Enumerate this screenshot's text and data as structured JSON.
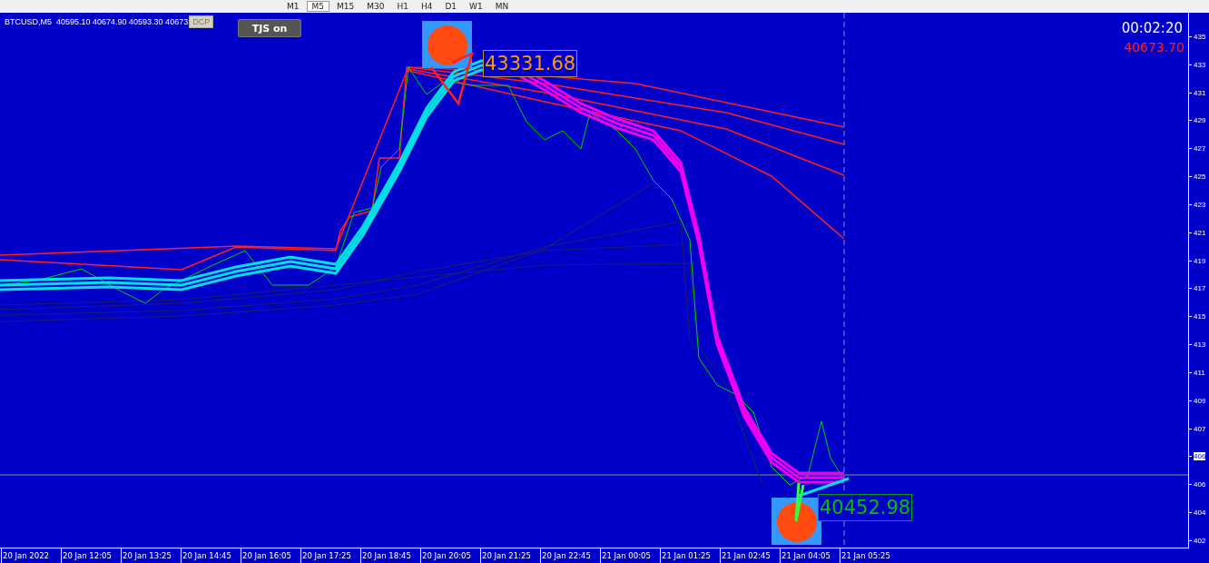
{
  "toolbar": {
    "timeframes": [
      {
        "label": "M1",
        "selected": false
      },
      {
        "label": "M5",
        "selected": true
      },
      {
        "label": "M15",
        "selected": false
      },
      {
        "label": "M30",
        "selected": false
      },
      {
        "label": "H1",
        "selected": false
      },
      {
        "label": "H4",
        "selected": false
      },
      {
        "label": "D1",
        "selected": false
      },
      {
        "label": "W1",
        "selected": false
      },
      {
        "label": "MN",
        "selected": false
      }
    ]
  },
  "chart": {
    "symbol_info": "BTCUSD,M5  40595.10 40674.90 40593.30 40673",
    "badge": "DCP",
    "toggle_button": "TJS on",
    "timer": "00:02:20",
    "bid": "40673.70",
    "high_label": "43331.68",
    "low_label": "40452.98",
    "price_axis": [
      {
        "label": "435",
        "kind": "tick"
      },
      {
        "label": "433",
        "kind": "tick"
      },
      {
        "label": "431",
        "kind": "tick"
      },
      {
        "label": "429",
        "kind": "tick"
      },
      {
        "label": "427",
        "kind": "tick"
      },
      {
        "label": "425",
        "kind": "tick"
      },
      {
        "label": "423",
        "kind": "tick"
      },
      {
        "label": "421",
        "kind": "tick"
      },
      {
        "label": "419",
        "kind": "tick"
      },
      {
        "label": "417",
        "kind": "tick"
      },
      {
        "label": "415",
        "kind": "tick"
      },
      {
        "label": "413",
        "kind": "tick"
      },
      {
        "label": "411",
        "kind": "tick"
      },
      {
        "label": "409",
        "kind": "tick"
      },
      {
        "label": "407",
        "kind": "tick"
      },
      {
        "label": "406",
        "kind": "current"
      },
      {
        "label": "406",
        "kind": "tick"
      },
      {
        "label": "404",
        "kind": "tick"
      },
      {
        "label": "402",
        "kind": "tick"
      }
    ],
    "time_axis": [
      "20 Jan 2022",
      "20 Jan 12:05",
      "20 Jan 13:25",
      "20 Jan 14:45",
      "20 Jan 16:05",
      "20 Jan 17:25",
      "20 Jan 18:45",
      "20 Jan 20:05",
      "20 Jan 21:25",
      "20 Jan 22:45",
      "21 Jan 00:05",
      "21 Jan 01:25",
      "21 Jan 02:45",
      "21 Jan 04:05",
      "21 Jan 05:25"
    ]
  }
}
